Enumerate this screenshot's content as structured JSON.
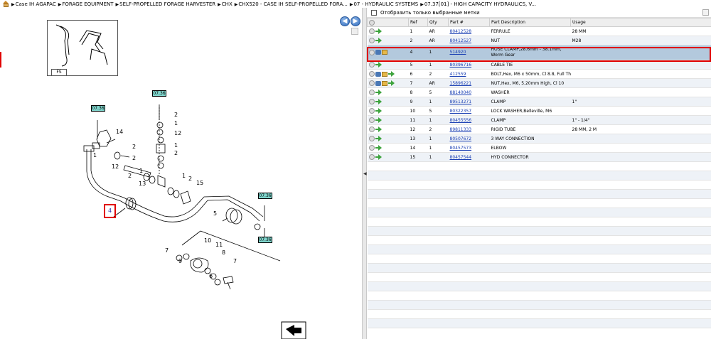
{
  "breadcrumb": [
    "Case IH AGAPAC",
    "FORAGE EQUIPMENT",
    "SELF-PROPELLED FORAGE HARVESTER",
    "CHX",
    "CHX520 - CASE IH SELF-PROPELLED FORA...",
    "07 - HYDRAULIC SYSTEMS",
    "07.37[01] - HIGH CAPACITY HYDRAULICS, V..."
  ],
  "toolbar": {
    "back_icon": "left-arrow-icon",
    "forward_icon": "right-arrow-icon",
    "thumbnail_label": "FS"
  },
  "diagram": {
    "callouts": [
      "07.36",
      "07.36",
      "07.36",
      "07.36"
    ],
    "numbers": {
      "n1": "14",
      "n2": "2",
      "n3": "1",
      "n4": "12",
      "n5": "2",
      "n6": "1",
      "n7": "2",
      "n8": "12",
      "n9": "2",
      "n10": "13",
      "n11": "1",
      "n12": "2",
      "n13": "15",
      "n14": "1",
      "n15": "12",
      "n16": "2",
      "n17": "5",
      "n18": "7",
      "n19": "10",
      "n20": "11",
      "n21": "9",
      "n22": "8",
      "n23": "7",
      "n24": "6"
    },
    "highlighted_number": "4"
  },
  "filter": {
    "label": "Отобразить только выбранные метки"
  },
  "table": {
    "headers": [
      "Ref",
      "Qty",
      "Part #",
      "Part Description",
      "Usage"
    ],
    "rows": [
      {
        "ref": "1",
        "qty": "AR",
        "part": "80412528",
        "desc": "FERRULE",
        "usage": "28 MM"
      },
      {
        "ref": "2",
        "qty": "AR",
        "part": "80412527",
        "desc": "NUT",
        "usage": "M28"
      },
      {
        "ref": "4",
        "qty": "1",
        "part": "514920",
        "desc": "HOSE CLAMP,28.6mm - 38.1mm, Worm Gear",
        "usage": ""
      },
      {
        "ref": "5",
        "qty": "1",
        "part": "80396716",
        "desc": "CABLE TIE",
        "usage": ""
      },
      {
        "ref": "6",
        "qty": "2",
        "part": "412559",
        "desc": "BOLT,Hex, M6 x 50mm, Cl 8.8, Full Thd",
        "usage": ""
      },
      {
        "ref": "7",
        "qty": "AR",
        "part": "15896221",
        "desc": "NUT,Hex, M6, 5.20mm High, Cl 10",
        "usage": ""
      },
      {
        "ref": "8",
        "qty": "5",
        "part": "88140040",
        "desc": "WASHER",
        "usage": ""
      },
      {
        "ref": "9",
        "qty": "1",
        "part": "89513271",
        "desc": "CLAMP",
        "usage": "1\""
      },
      {
        "ref": "10",
        "qty": "5",
        "part": "80322357",
        "desc": "LOCK WASHER,Belleville, M6",
        "usage": ""
      },
      {
        "ref": "11",
        "qty": "1",
        "part": "80455556",
        "desc": "CLAMP",
        "usage": "1\" - 1/4\""
      },
      {
        "ref": "12",
        "qty": "2",
        "part": "89811333",
        "desc": "RIGID TUBE",
        "usage": "28 MM, 2 M"
      },
      {
        "ref": "13",
        "qty": "1",
        "part": "80507672",
        "desc": "3 WAY CONNECTION",
        "usage": ""
      },
      {
        "ref": "14",
        "qty": "1",
        "part": "80457573",
        "desc": "ELBOW",
        "usage": ""
      },
      {
        "ref": "15",
        "qty": "1",
        "part": "80457544",
        "desc": "HYD CONNECTOR",
        "usage": ""
      }
    ]
  }
}
